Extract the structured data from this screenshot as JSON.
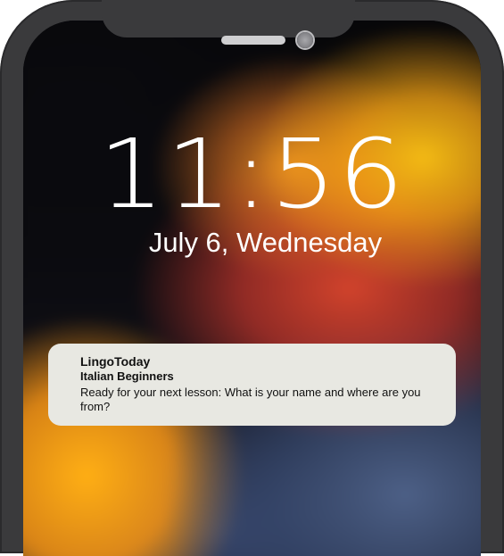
{
  "lock_screen": {
    "time": "11:56",
    "date": "July 6, Wednesday"
  },
  "notification": {
    "app_name": "LingoToday",
    "subtitle": "Italian Beginners",
    "message": "Ready for your next lesson: What is your name and where are you from?"
  },
  "colors": {
    "device_frame": "#3a3a3c",
    "notification_background": "#e8e8e2",
    "wallpaper_accent_yellow": "#ffb814",
    "wallpaper_accent_red": "#d8463a",
    "wallpaper_accent_blue": "#506488"
  }
}
